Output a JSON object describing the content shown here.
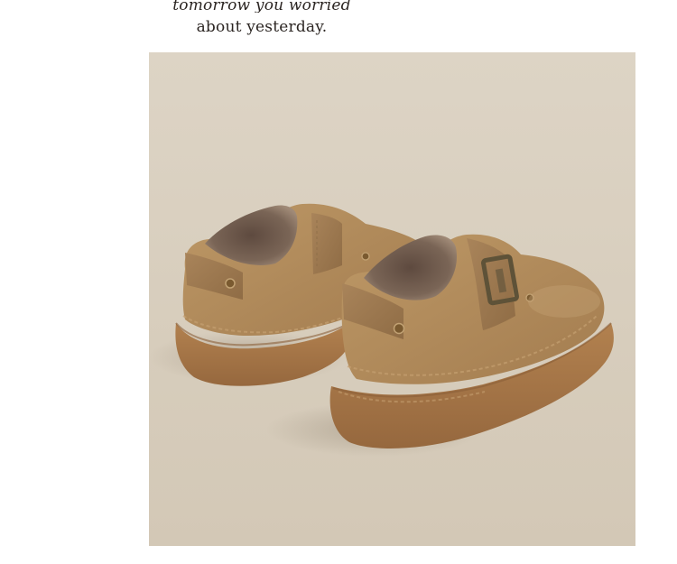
{
  "caption": {
    "line1": "tomorrow you worried",
    "line2": "about yesterday."
  },
  "photo": {
    "subject": "pair-of-suede-platform-monk-strap-shoes",
    "background_color": "#d9cfbf",
    "suede_color": "#b08a5a",
    "sole_color": "#a87a4c",
    "fur_lining_color": "#7a6556"
  }
}
